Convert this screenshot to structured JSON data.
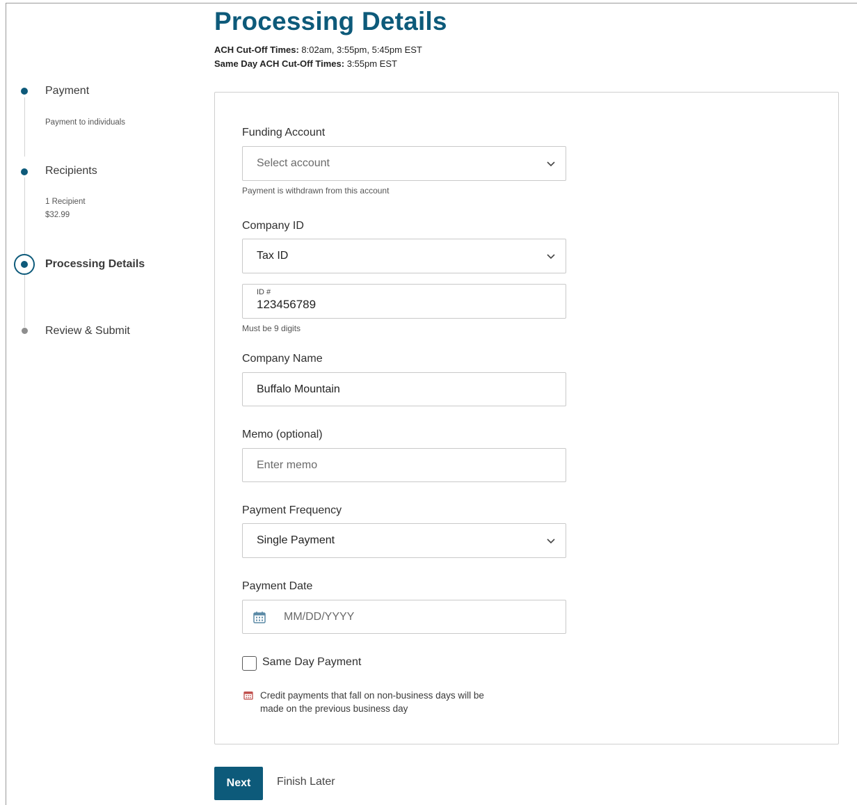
{
  "stepper": {
    "steps": [
      {
        "label": "Payment",
        "sub": [
          "Payment to individuals"
        ],
        "state": "done"
      },
      {
        "label": "Recipients",
        "sub": [
          "1 Recipient",
          "$32.99"
        ],
        "state": "done"
      },
      {
        "label": "Processing Details",
        "sub": [],
        "state": "current"
      },
      {
        "label": "Review & Submit",
        "sub": [],
        "state": "future"
      }
    ]
  },
  "header": {
    "title": "Processing Details",
    "ach_label": "ACH Cut-Off Times:",
    "ach_value": " 8:02am, 3:55pm, 5:45pm EST",
    "same_day_label": "Same Day ACH Cut-Off Times:",
    "same_day_value": " 3:55pm EST"
  },
  "form": {
    "funding_account": {
      "label": "Funding Account",
      "placeholder": "Select account",
      "help": "Payment is withdrawn from this account"
    },
    "company_id": {
      "label": "Company ID",
      "selected": "Tax ID",
      "id_label": "ID #",
      "id_value": "123456789",
      "help": "Must be 9 digits"
    },
    "company_name": {
      "label": "Company Name",
      "value": "Buffalo Mountain"
    },
    "memo": {
      "label": "Memo (optional)",
      "placeholder": "Enter memo"
    },
    "payment_frequency": {
      "label": "Payment Frequency",
      "selected": "Single Payment"
    },
    "payment_date": {
      "label": "Payment Date",
      "placeholder": "MM/DD/YYYY"
    },
    "same_day": {
      "label": "Same Day Payment",
      "checked": false
    },
    "note": "Credit payments that fall on non-business days will be made on the previous business day"
  },
  "actions": {
    "next_label": "Next",
    "finish_later_label": "Finish Later"
  },
  "colors": {
    "accent": "#0d5a7a",
    "border": "#c9c9c9",
    "note_icon": "#c0504d"
  },
  "icons": {
    "select_chevron": "chevron-down-icon",
    "date": "calendar-icon",
    "note": "calendar-icon"
  }
}
